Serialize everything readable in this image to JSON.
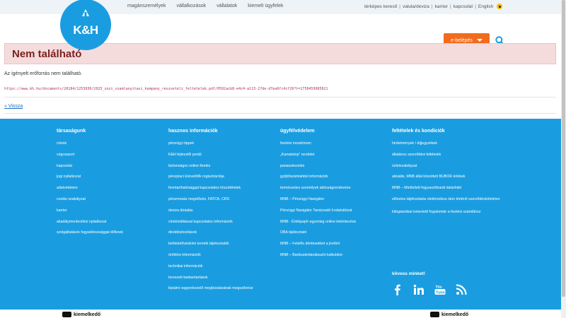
{
  "topnav": [
    "magánszemélyek",
    "vállalkozások",
    "vállalatok",
    "kiemelt ügyfelek"
  ],
  "rightnav": [
    "térképes kereső",
    "valuta/deviza",
    "karrier",
    "kapcsolat",
    "English"
  ],
  "logo_text": "K&H",
  "login_label": "e-belépés",
  "error_title": "Nem található",
  "message": "Az igényelt erőforrás nem található.",
  "url": "https://www.kh.hu/documents/20184/1253930/2025_zozi_szamlanyitasi_kampany_reszveteli_feltetelek.pdf/0592acb8-e4c4-a113-27de-d7ea6fc4cf20?t=1750459985021",
  "back_label": "« Vissza",
  "footer": {
    "columns": [
      {
        "title": "társaságunk",
        "links": [
          "rólunk",
          "cégcsoport",
          "kapcsolat",
          "jogi nyilatkozat",
          "adatvédelem",
          "cookie szabályzat",
          "karrier",
          "akadálymentesítési nyilatkozat",
          "szolgáltatások fogyatékossággal élőknek"
        ]
      },
      {
        "title": "hasznos információk",
        "links": [
          "pénzügyi tippek",
          "K&H fejlesztői portál",
          "biztonságos online fizetés",
          "pénzpiaci közvetítők regisztrációja",
          "fenntarthatósággal kapcsolatos közzétételek",
          "pénzmosás megelőzés, FATCA, CRS",
          "deviza átutalás",
          "címletváltással kapcsolatos információk",
          "direktbiztosítások",
          "befektetővédelmi termék tájékoztatók",
          "öröklési információk",
          "technikai információk",
          "tervezett karbantartások",
          "bizalmi vagyonkezelő megbízatásának megszűnése"
        ]
      },
      {
        "title": "ügyfélvédelem",
        "links": [
          "fizetési moratórium",
          "„Kamatstop” rendelet",
          "panaszkezelés",
          "gyűjtőszámlahitel információk",
          "természetes személyek adósságrendezése",
          "MNB – Pénzügyi Navigátor",
          "Pénzügyi Navigátor Tanácsadó Irodahálózat",
          "MNB - Értékpapír egyenleg online lekérdezése",
          "OBA tájékoztató",
          "MNB – Felelős döntésekkel a jövőért",
          "MNB – Bankszámlaválasztó kalkulátor"
        ]
      },
      {
        "title": "feltételek és kondíciók",
        "links": [
          "hirdetmények / díjjegyzékek",
          "általános szerződési feltételek",
          "üzletszabályzat",
          "aktuális, MNB által közzétett BUBOR értékek",
          "MNB – Minősített fogyasztóbarát lakáshitel",
          "előzetes tájékoztatás elektronikus úton történő szerződéskötéshez",
          "kifogásokkal ismertető fogalomtár a fizetési számlához"
        ]
      }
    ],
    "follow_label": "kövess minket!",
    "social": [
      "facebook-icon",
      "linkedin-icon",
      "youtube-icon",
      "rss-icon"
    ]
  },
  "badges": [
    "kiemelkedő",
    "kiemelkedő"
  ],
  "colors": {
    "brand_blue": "#1a9de0",
    "accent_orange": "#f26b1d",
    "error_bg": "#f5dcdc",
    "error_text": "#7b2121"
  }
}
